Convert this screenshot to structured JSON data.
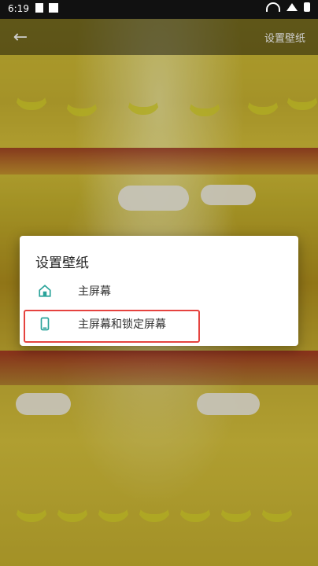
{
  "status_bar": {
    "time": "6:19"
  },
  "app_bar": {
    "back_icon": "arrow-left-icon",
    "action_label": "设置壁纸"
  },
  "dialog": {
    "title": "设置壁纸",
    "options": [
      {
        "label": "主屏幕",
        "icon": "home-icon"
      },
      {
        "label": "主屏幕和锁定屏幕",
        "icon": "phone-icon"
      }
    ]
  },
  "colors": {
    "accent": "#2aa39a",
    "highlight": "#e5433f"
  }
}
